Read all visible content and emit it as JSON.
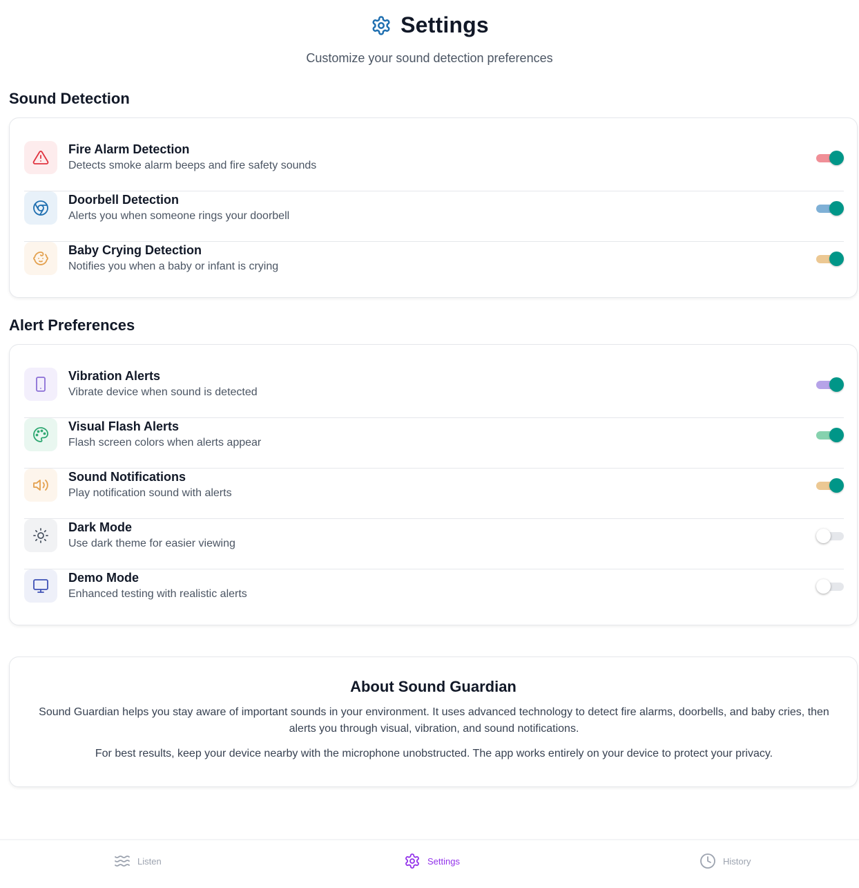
{
  "header": {
    "title": "Settings",
    "title_icon": "gear-icon",
    "subtitle": "Customize your sound detection preferences",
    "accent_color": "#1f6fb0"
  },
  "sound_detection": {
    "title": "Sound Detection",
    "items": [
      {
        "title": "Fire Alarm Detection",
        "description": "Detects smoke alarm beeps and fire safety sounds",
        "icon": "alert-triangle-icon",
        "icon_color": "#e0333f",
        "icon_bg": "#fdeced",
        "track_color": "#f08f97",
        "enabled": true
      },
      {
        "title": "Doorbell Detection",
        "description": "Alerts you when someone rings your doorbell",
        "icon": "doorbell-icon",
        "icon_color": "#1f6fb0",
        "icon_bg": "#e8f1f9",
        "track_color": "#7fb0d6",
        "enabled": true
      },
      {
        "title": "Baby Crying Detection",
        "description": "Notifies you when a baby or infant is crying",
        "icon": "baby-icon",
        "icon_color": "#e3a04d",
        "icon_bg": "#fdf5ec",
        "track_color": "#ecc893",
        "enabled": true
      }
    ]
  },
  "alert_preferences": {
    "title": "Alert Preferences",
    "items": [
      {
        "title": "Vibration Alerts",
        "description": "Vibrate device when sound is detected",
        "icon": "smartphone-icon",
        "icon_color": "#8b6fd6",
        "icon_bg": "#f3effc",
        "track_color": "#b6a3e8",
        "enabled": true
      },
      {
        "title": "Visual Flash Alerts",
        "description": "Flash screen colors when alerts appear",
        "icon": "palette-icon",
        "icon_color": "#2fa872",
        "icon_bg": "#e9f7f0",
        "track_color": "#86d2ae",
        "enabled": true
      },
      {
        "title": "Sound Notifications",
        "description": "Play notification sound with alerts",
        "icon": "speaker-icon",
        "icon_color": "#e3a04d",
        "icon_bg": "#fdf5ec",
        "track_color": "#ecc893",
        "enabled": true
      },
      {
        "title": "Dark Mode",
        "description": "Use dark theme for easier viewing",
        "icon": "sun-icon",
        "icon_color": "#4b5563",
        "icon_bg": "#f1f2f4",
        "track_color": "#e5e7eb",
        "enabled": false
      },
      {
        "title": "Demo Mode",
        "description": "Enhanced testing with realistic alerts",
        "icon": "monitor-icon",
        "icon_color": "#3f51b5",
        "icon_bg": "#eef0f9",
        "track_color": "#e5e7eb",
        "enabled": false
      }
    ]
  },
  "about": {
    "title": "About Sound Guardian",
    "paragraph1_line1": "Sound Guardian helps you stay aware of important sounds in your environment. It uses advanced technology to detect fire alarms, doorbells, and baby cries, then",
    "paragraph1_line2": "alerts you through visual, vibration, and sound notifications.",
    "paragraph2": "For best results, keep your device nearby with the microphone unobstructed. The app works entirely on your device to protect your privacy."
  },
  "nav": {
    "active_color": "#9333ea",
    "inactive_color": "#9ca3af",
    "items": [
      {
        "label": "Listen",
        "icon": "waves-icon",
        "active": false
      },
      {
        "label": "Settings",
        "icon": "gear-icon",
        "active": true
      },
      {
        "label": "History",
        "icon": "clock-icon",
        "active": false
      }
    ]
  }
}
